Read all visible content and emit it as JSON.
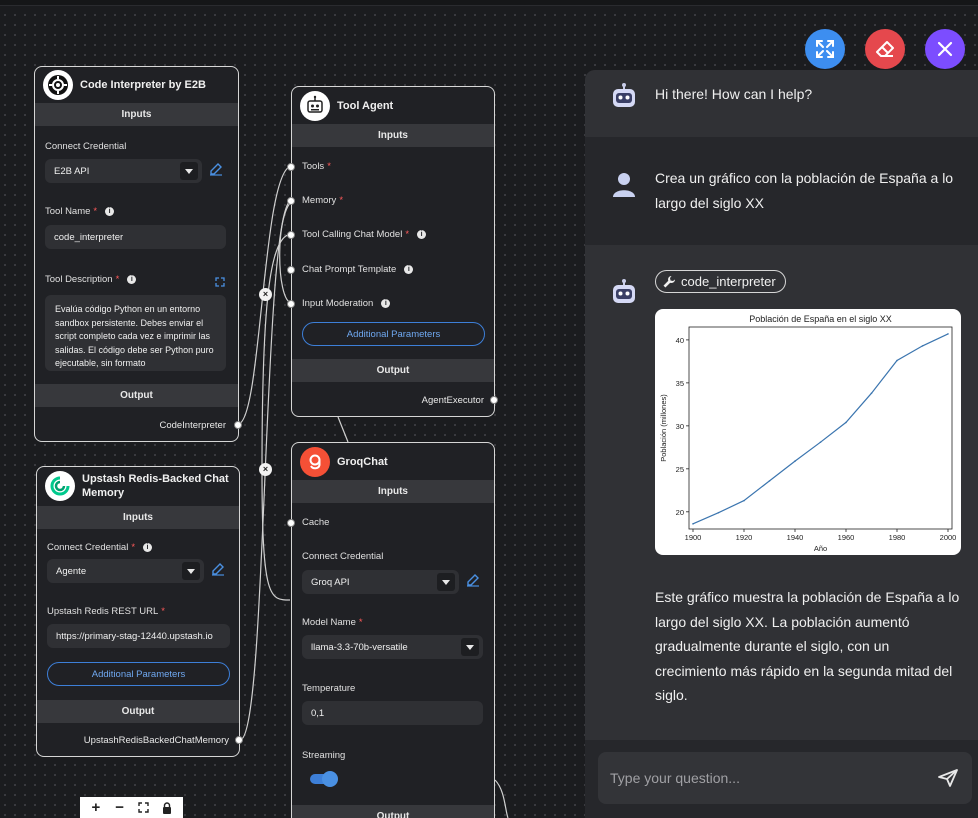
{
  "canvas": {
    "nodes": {
      "code_interpreter": {
        "title": "Code Interpreter by E2B",
        "inputs_label": "Inputs",
        "credential_label": "Connect Credential",
        "credential_value": "E2B API",
        "tool_name_label": "Tool Name",
        "tool_name_value": "code_interpreter",
        "tool_description_label": "Tool Description",
        "tool_description_value": "Evalúa código Python en un entorno sandbox persistente. Debes enviar el script completo cada vez e imprimir las salidas. El código debe ser Python puro ejecutable, sin formato",
        "output_label": "Output",
        "output_value": "CodeInterpreter"
      },
      "upstash_memory": {
        "title": "Upstash Redis-Backed Chat Memory",
        "inputs_label": "Inputs",
        "credential_label": "Connect Credential",
        "credential_value": "Agente",
        "url_label": "Upstash Redis REST URL",
        "url_value": "https://primary-stag-12440.upstash.io",
        "additional_params": "Additional Parameters",
        "output_label": "Output",
        "output_value": "UpstashRedisBackedChatMemory"
      },
      "tool_agent": {
        "title": "Tool Agent",
        "inputs_label": "Inputs",
        "anchors": [
          "Tools",
          "Memory",
          "Tool Calling Chat Model",
          "Chat Prompt Template",
          "Input Moderation"
        ],
        "additional_params": "Additional Parameters",
        "output_label": "Output",
        "output_value": "AgentExecutor"
      },
      "groq_chat": {
        "title": "GroqChat",
        "inputs_label": "Inputs",
        "cache_label": "Cache",
        "credential_label": "Connect Credential",
        "credential_value": "Groq API",
        "model_label": "Model Name",
        "model_value": "llama-3.3-70b-versatile",
        "temperature_label": "Temperature",
        "temperature_value": "0,1",
        "streaming_label": "Streaming",
        "streaming_on": true,
        "output_label": "Output"
      }
    },
    "controls": [
      "zoom-in",
      "zoom-out",
      "fit-view",
      "lock"
    ]
  },
  "actions": {
    "expand_color": "#3d8ef0",
    "clear_color": "#e5484d",
    "close_color": "#7c4dff"
  },
  "chat": {
    "greeting": "Hi there! How can I help?",
    "user_message": "Crea un gráfico con la población de España a lo largo del siglo XX",
    "tool_used": "code_interpreter",
    "bot_answer": "Este gráfico muestra la población de España a lo largo del siglo XX. La población aumentó gradualmente durante el siglo, con un crecimiento más rápido en la segunda mitad del siglo.",
    "input_placeholder": "Type your question..."
  },
  "chart_data": {
    "type": "line",
    "title": "Población de España en el siglo XX",
    "xlabel": "Año",
    "ylabel": "Población (millones)",
    "x": [
      1900,
      1910,
      1920,
      1930,
      1940,
      1950,
      1960,
      1970,
      1980,
      1990,
      2000
    ],
    "values": [
      18.6,
      19.9,
      21.3,
      23.6,
      25.9,
      28.1,
      30.4,
      33.8,
      37.6,
      39.3,
      40.7
    ],
    "xticks": [
      1900,
      1920,
      1940,
      1960,
      1980,
      2000
    ],
    "yticks": [
      20,
      25,
      30,
      35,
      40
    ],
    "xlim": [
      1900,
      2000
    ],
    "ylim": [
      18,
      41.5
    ],
    "line_color": "#3b75af",
    "grid": false
  }
}
